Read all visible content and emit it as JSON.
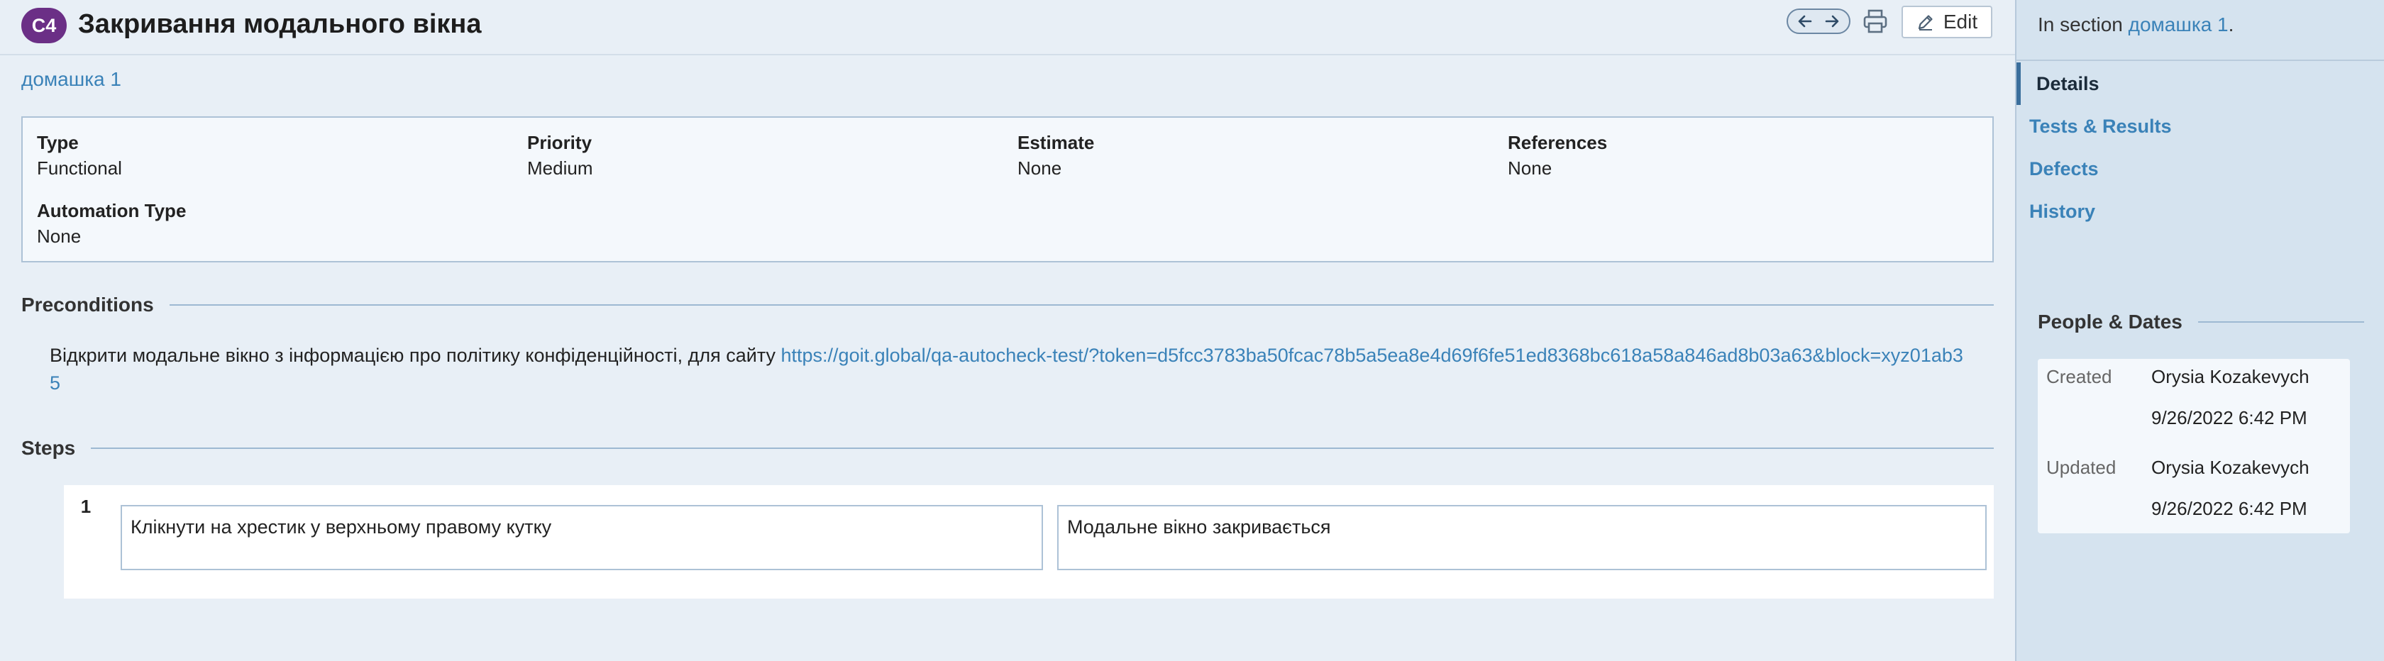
{
  "header": {
    "case_id": "C4",
    "title": "Закривання модального вікна",
    "edit_label": "Edit"
  },
  "section_link": "домашка 1",
  "fields": {
    "type": {
      "label": "Type",
      "value": "Functional"
    },
    "priority": {
      "label": "Priority",
      "value": "Medium"
    },
    "estimate": {
      "label": "Estimate",
      "value": "None"
    },
    "references": {
      "label": "References",
      "value": "None"
    },
    "automation_type": {
      "label": "Automation Type",
      "value": "None"
    }
  },
  "preconditions": {
    "heading": "Preconditions",
    "text": "Відкрити модальне вікно з інформацією про політику конфіденційності, для сайту ",
    "link": "https://goit.global/qa-autocheck-test/?token=d5fcc3783ba50fcac78b5a5ea8e4d69f6fe51ed8368bc618a58a846ad8b03a63&block=xyz01ab35"
  },
  "steps": {
    "heading": "Steps",
    "items": [
      {
        "number": "1",
        "action": "Клікнути на хрестик у верхньому правому кутку",
        "expected": "Модальне вікно закривається"
      }
    ]
  },
  "sidebar": {
    "in_section_prefix": "In section ",
    "in_section_link": "домашка 1",
    "in_section_suffix": ".",
    "nav": [
      {
        "label": "Details",
        "active": true
      },
      {
        "label": "Tests & Results",
        "active": false
      },
      {
        "label": "Defects",
        "active": false
      },
      {
        "label": "History",
        "active": false
      }
    ],
    "people_heading": "People & Dates",
    "created_label": "Created",
    "created_by": "Orysia Kozakevych",
    "created_at": "9/26/2022 6:42 PM",
    "updated_label": "Updated",
    "updated_by": "Orysia Kozakevych",
    "updated_at": "9/26/2022 6:42 PM"
  },
  "icons": {
    "arrow_left": "arrow-left-icon",
    "arrow_right": "arrow-right-icon",
    "print": "printer-icon",
    "edit": "pencil-icon"
  },
  "colors": {
    "badge": "#6b2f86",
    "link": "#3a82b8",
    "background": "#e8eff6",
    "sidebar": "#d5e3ef"
  }
}
